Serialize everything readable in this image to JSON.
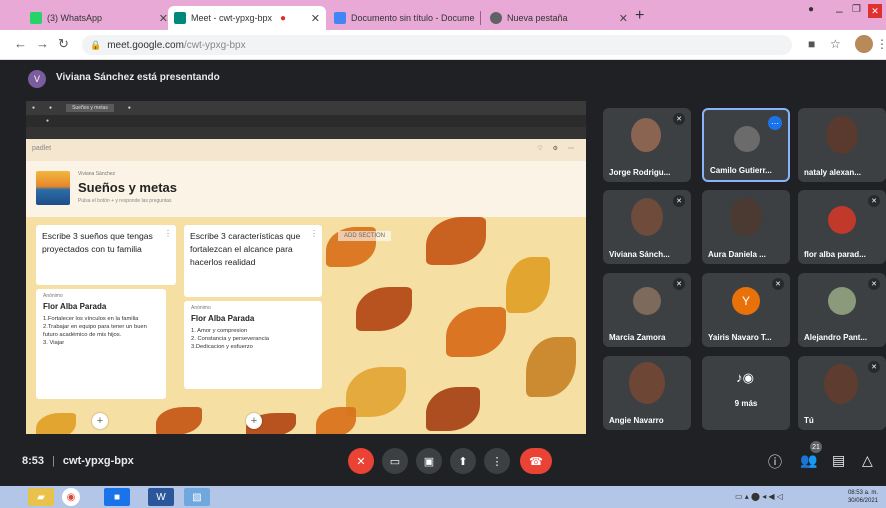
{
  "browser": {
    "tabs": [
      {
        "title": "(3) WhatsApp",
        "icon_color": "#25d366"
      },
      {
        "title": "Meet - cwt-ypxg-bpx",
        "icon_color": "#00897b"
      },
      {
        "title": "Documento sin título - Docume",
        "icon_color": "#4285f4"
      },
      {
        "title": "Nueva pestaña",
        "icon_color": "#5f6368"
      }
    ],
    "url_host": "meet.google.com",
    "url_path": "/cwt-ypxg-bpx"
  },
  "meet": {
    "presenter_banner": "Viviana Sánchez está presentando",
    "meeting_time": "8:53",
    "meeting_code": "cwt-ypxg-bpx",
    "people_count": "21",
    "participants": [
      {
        "name": "Jorge Rodrigu..."
      },
      {
        "name": "Camilo Gutierr..."
      },
      {
        "name": "nataly alexan..."
      },
      {
        "name": "Viviana Sánch..."
      },
      {
        "name": "Aura Daniela ..."
      },
      {
        "name": "flor alba parad..."
      },
      {
        "name": "Marcia Zamora"
      },
      {
        "name": "Yairis Navaro T...",
        "initial": "Y"
      },
      {
        "name": "Alejandro Pant..."
      },
      {
        "name": "Angie Navarro"
      },
      {
        "name": "9 más"
      },
      {
        "name": "Tú"
      }
    ]
  },
  "padlet": {
    "logo": "padlet",
    "title": "Sueños y metas",
    "subtitle": "Pulsa el botón + y responde las preguntas",
    "author": "Viviana Sánchez",
    "add_section": "ADD SECTION",
    "columns": [
      {
        "heading": "Escribe 3 sueños que tengas proyectados con tu familia"
      },
      {
        "heading": "Escribe 3 características que fortalezcan el alcance para hacerlos realidad"
      }
    ],
    "posts": [
      {
        "author": "Anónimo",
        "title": "Flor Alba Parada",
        "lines": [
          "1.Fortalecer los vínculos en la familia",
          "2.Trabajar en equipo para tener un buen futuro académico de mis hijos.",
          "3. Viajar"
        ]
      },
      {
        "author": "Anónimo",
        "title": "Flor Alba Parada",
        "lines": [
          "1. Amor y compresion",
          "2. Constancia y perseverancia",
          "3.Dedicacion y esfuerzo"
        ]
      }
    ]
  },
  "taskbar": {
    "time": "08:53 a. m.",
    "date": "30/06/2021"
  },
  "colors": {
    "tabstrip": "#e8a9d7",
    "meet_bg": "#202124",
    "tile_bg": "#3c4043",
    "end_call": "#ea4335",
    "padlet_bg": "#f5dfa3"
  }
}
